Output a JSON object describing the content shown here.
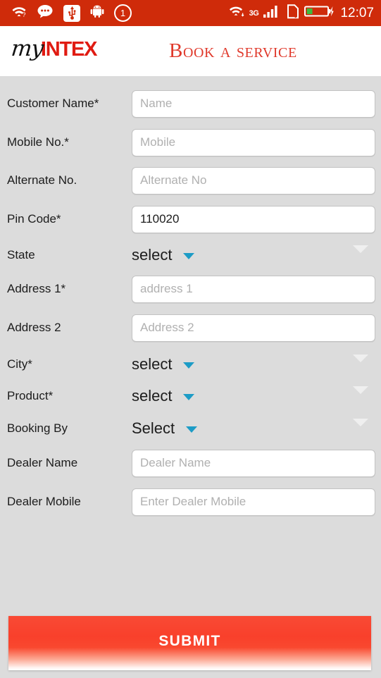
{
  "statusbar": {
    "left_icons": [
      {
        "name": "wifi-question-icon",
        "glyph": "wifi"
      },
      {
        "name": "chat-bubble-icon",
        "glyph": "chat"
      },
      {
        "name": "usb-icon",
        "glyph": "usb"
      },
      {
        "name": "android-robot-icon",
        "glyph": "android"
      },
      {
        "name": "notification-count-icon",
        "label": "1"
      }
    ],
    "notification_count": "1",
    "network_type": "3G",
    "time": "12:07",
    "bg_color": "#cf2b0a",
    "battery_color": "#3dbb3d"
  },
  "header": {
    "logo_prefix": "my",
    "logo_brand": "INTEX",
    "title": "Book a service",
    "brand_color": "#e01b12",
    "title_color": "#e0392b"
  },
  "form": {
    "fields": [
      {
        "label": "Customer Name*",
        "type": "text",
        "placeholder": "Name",
        "value": ""
      },
      {
        "label": "Mobile No.*",
        "type": "text",
        "placeholder": "Mobile",
        "value": ""
      },
      {
        "label": "Alternate No.",
        "type": "text",
        "placeholder": "Alternate No",
        "value": ""
      },
      {
        "label": "Pin Code*",
        "type": "text",
        "placeholder": "",
        "value": "110020"
      },
      {
        "label": "State",
        "type": "select",
        "value": "select"
      },
      {
        "label": "Address 1*",
        "type": "text",
        "placeholder": "address 1",
        "value": ""
      },
      {
        "label": "Address 2",
        "type": "text",
        "placeholder": "Address 2",
        "value": ""
      },
      {
        "label": "City*",
        "type": "select",
        "value": "select"
      },
      {
        "label": "Product*",
        "type": "select",
        "value": "select"
      },
      {
        "label": "Booking By",
        "type": "select",
        "value": "Select"
      },
      {
        "label": "Dealer Name",
        "type": "text",
        "placeholder": "Dealer Name",
        "value": ""
      },
      {
        "label": "Dealer Mobile",
        "type": "text",
        "placeholder": "Enter Dealer Mobile",
        "value": ""
      }
    ],
    "background_color": "#dcdcdc",
    "caret_color": "#1d9cc6"
  },
  "submit": {
    "label": "SUBMIT",
    "color": "#f9402b"
  }
}
